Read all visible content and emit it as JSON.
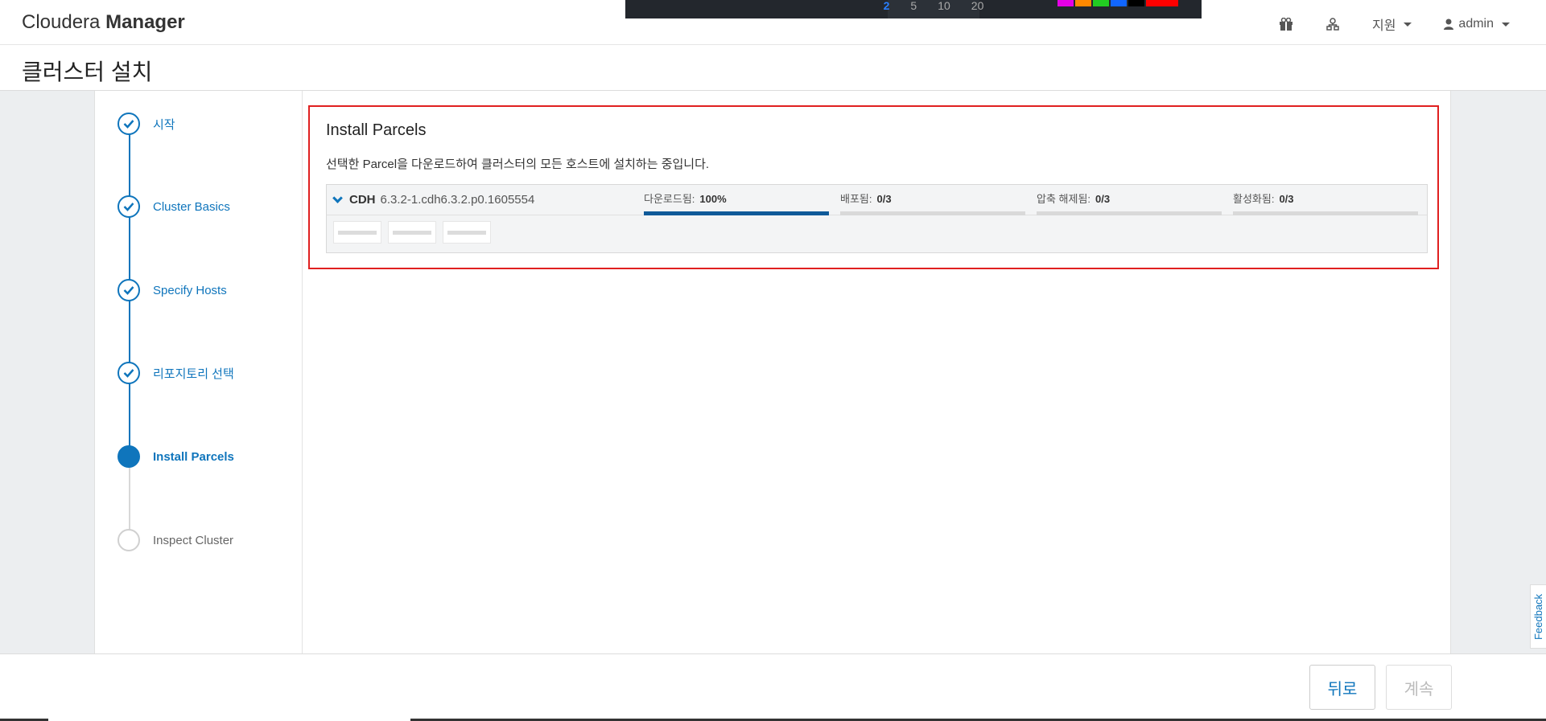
{
  "brand": {
    "prefix": "Cloudera",
    "bold": "Manager"
  },
  "nav": {
    "icons": [
      "gift-icon",
      "network-icon"
    ],
    "support_label": "지원",
    "user_label": "admin"
  },
  "overlay": {
    "numbers": [
      "2",
      "5",
      "10",
      "20"
    ],
    "colors": [
      "#e600e6",
      "#ff8800",
      "#22cc22",
      "#1166ff",
      "#000000",
      "#ff0000"
    ]
  },
  "page": {
    "title": "클러스터 설치"
  },
  "steps": [
    {
      "label": "시작",
      "state": "done"
    },
    {
      "label": "Cluster Basics",
      "state": "done"
    },
    {
      "label": "Specify Hosts",
      "state": "done"
    },
    {
      "label": "리포지토리 선택",
      "state": "done"
    },
    {
      "label": "Install Parcels",
      "state": "active"
    },
    {
      "label": "Inspect Cluster",
      "state": "pending"
    }
  ],
  "section": {
    "title": "Install Parcels",
    "description": "선택한 Parcel을 다운로드하여 클러스터의 모든 호스트에 설치하는 중입니다."
  },
  "parcel": {
    "name": "CDH",
    "version": "6.3.2-1.cdh6.3.2.p0.1605554",
    "stages": [
      {
        "label": "다운로드됨:",
        "value": "100%",
        "progress": 1.0
      },
      {
        "label": "배포됨:",
        "value": "0/3",
        "progress": 0.0
      },
      {
        "label": "압축 해제됨:",
        "value": "0/3",
        "progress": 0.0
      },
      {
        "label": "활성화됨:",
        "value": "0/3",
        "progress": 0.0
      }
    ]
  },
  "feedback": {
    "label": "Feedback"
  },
  "footer": {
    "back_label": "뒤로",
    "continue_label": "계속"
  }
}
